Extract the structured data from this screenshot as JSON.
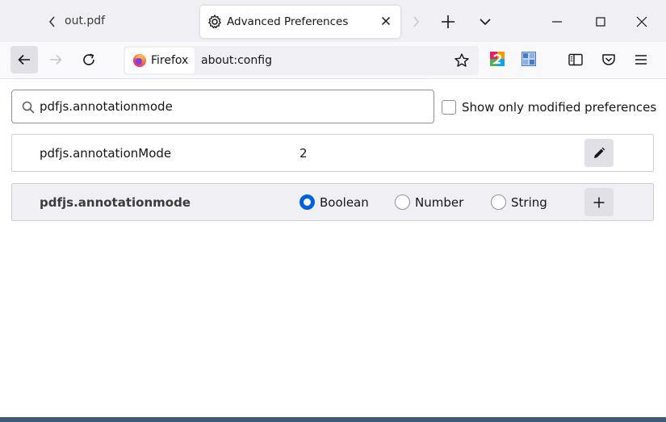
{
  "tabs": {
    "inactive_label": "out.pdf",
    "active_title": "Advanced Preferences"
  },
  "navbar": {
    "identity_label": "Firefox",
    "url": "about:config"
  },
  "search": {
    "value": "pdfjs.annotationmode",
    "placeholder": ""
  },
  "filters": {
    "modified_only_label": "Show only modified preferences",
    "modified_only_checked": false
  },
  "preferences": [
    {
      "name": "pdfjs.annotationMode",
      "value": "2"
    }
  ],
  "new_pref": {
    "name": "pdfjs.annotationmode",
    "types": [
      {
        "label": "Boolean",
        "checked": true
      },
      {
        "label": "Number",
        "checked": false
      },
      {
        "label": "String",
        "checked": false
      }
    ]
  },
  "colors": {
    "accent": "#0061e0",
    "tabstrip": "#f0f0f4",
    "toolbar": "#f9f9fb"
  },
  "icons": {
    "settings": "gear-icon",
    "close": "close-icon",
    "new_tab": "plus-icon",
    "tab_list": "chevron-down-icon",
    "back": "back-arrow-icon",
    "forward": "forward-arrow-icon",
    "reload": "reload-icon",
    "bookmark": "star-icon",
    "sidebar": "sidebar-icon",
    "pocket": "pocket-icon",
    "menu": "hamburger-menu-icon",
    "edit": "pencil-icon",
    "add": "plus-icon",
    "search": "search-icon"
  }
}
